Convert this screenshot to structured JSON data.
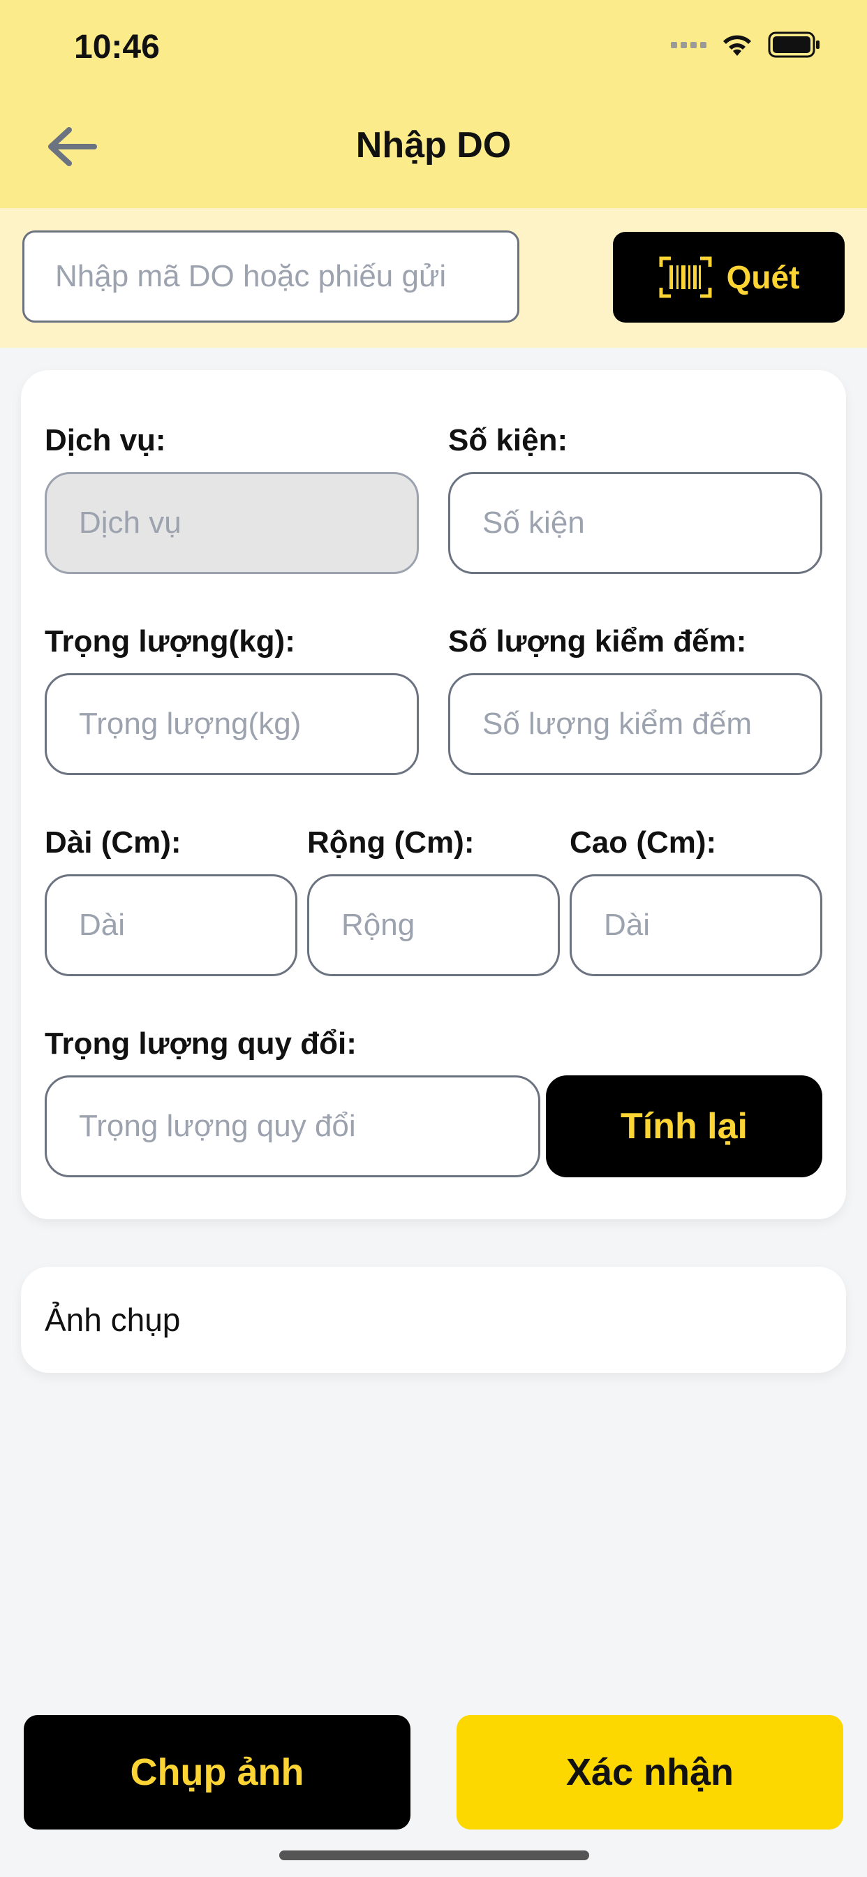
{
  "status_bar": {
    "time": "10:46"
  },
  "header": {
    "title": "Nhập DO"
  },
  "search": {
    "placeholder": "Nhập mã DO hoặc phiếu gửi",
    "scan_label": "Quét"
  },
  "form": {
    "service": {
      "label": "Dịch vụ:",
      "placeholder": "Dịch vụ"
    },
    "packages": {
      "label": "Số kiện:",
      "placeholder": "Số kiện"
    },
    "weight": {
      "label": "Trọng lượng(kg):",
      "placeholder": "Trọng lượng(kg)"
    },
    "count": {
      "label": "Số lượng kiểm đếm:",
      "placeholder": "Số lượng kiểm đếm"
    },
    "length": {
      "label": "Dài (Cm):",
      "placeholder": "Dài"
    },
    "width": {
      "label": "Rộng (Cm):",
      "placeholder": "Rộng"
    },
    "height": {
      "label": "Cao (Cm):",
      "placeholder": "Dài"
    },
    "converted_weight": {
      "label": "Trọng lượng quy đổi:",
      "placeholder": "Trọng lượng quy đổi"
    },
    "recalc_label": "Tính lại"
  },
  "photos": {
    "label": "Ảnh chụp"
  },
  "actions": {
    "capture_label": "Chụp ảnh",
    "confirm_label": "Xác nhận"
  },
  "colors": {
    "header_bg": "#FCEB8A",
    "strip_bg": "#FEF3C7",
    "accent_yellow": "#FCD535",
    "confirm_yellow": "#FCD800",
    "black": "#000000"
  },
  "icons": {
    "back": "arrow-left-icon",
    "scan": "barcode-scan-icon",
    "wifi": "wifi-icon",
    "battery": "battery-icon",
    "signal": "cellular-signal-icon"
  }
}
